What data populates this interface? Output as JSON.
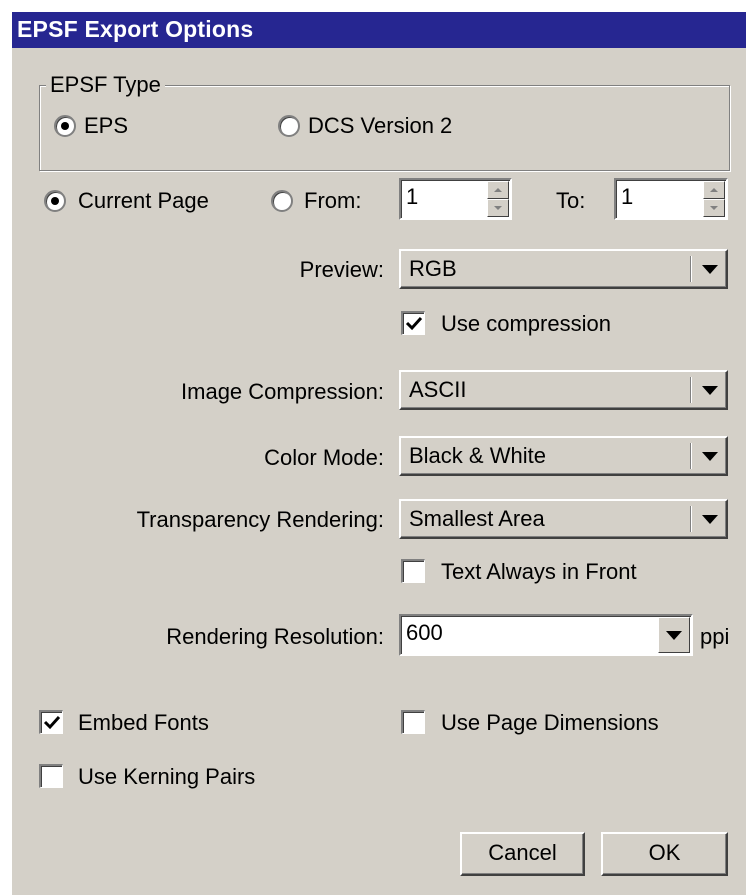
{
  "window": {
    "title": "EPSF Export Options"
  },
  "epsf_type": {
    "legend": "EPSF Type",
    "options": [
      {
        "label": "EPS",
        "checked": true
      },
      {
        "label": "DCS Version 2",
        "checked": false
      }
    ]
  },
  "page_range": {
    "current_page_label": "Current Page",
    "current_page_checked": true,
    "from_label": "From:",
    "from_value": "1",
    "to_label": "To:",
    "to_value": "1"
  },
  "preview": {
    "label": "Preview:",
    "value": "RGB"
  },
  "use_compression": {
    "label": "Use compression",
    "checked": true
  },
  "image_compression": {
    "label": "Image Compression:",
    "value": "ASCII"
  },
  "color_mode": {
    "label": "Color Mode:",
    "value": "Black & White"
  },
  "transparency_rendering": {
    "label": "Transparency Rendering:",
    "value": "Smallest Area"
  },
  "text_always_in_front": {
    "label": "Text Always in Front",
    "checked": false
  },
  "rendering_resolution": {
    "label": "Rendering Resolution:",
    "value": "600",
    "unit": "ppi"
  },
  "embed_fonts": {
    "label": "Embed Fonts",
    "checked": true
  },
  "use_page_dimensions": {
    "label": "Use Page Dimensions",
    "checked": false
  },
  "use_kerning_pairs": {
    "label": "Use Kerning Pairs",
    "checked": false
  },
  "buttons": {
    "cancel": "Cancel",
    "ok": "OK"
  }
}
